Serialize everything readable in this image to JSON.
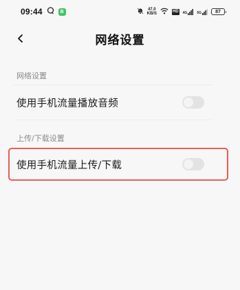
{
  "status_bar": {
    "time": "09:44",
    "app_badge": "B",
    "net_speed_value": "47.0",
    "net_speed_unit": "KB/S",
    "hd_label": "HD",
    "sig1_label": "4G",
    "sig2_label": "5G",
    "battery_level": "87",
    "icons": [
      "chat-bubble-icon",
      "do-not-disturb-bell-icon",
      "wifi-icon",
      "signal-icon",
      "battery-icon"
    ]
  },
  "nav": {
    "title": "网络设置",
    "back_icon": "chevron-left-icon"
  },
  "sections": [
    {
      "header": "网络设置",
      "items": [
        {
          "label": "使用手机流量播放音频",
          "toggle_on": false
        }
      ]
    },
    {
      "header": "上传/下载设置",
      "items": [
        {
          "label": "使用手机流量上传/下载",
          "toggle_on": false,
          "highlighted": true
        }
      ]
    }
  ],
  "colors": {
    "background": "#f7f7f7",
    "toggle_off": "#e3e3e3",
    "highlight": "#ec5a55",
    "section_header": "#8a8a8a"
  }
}
